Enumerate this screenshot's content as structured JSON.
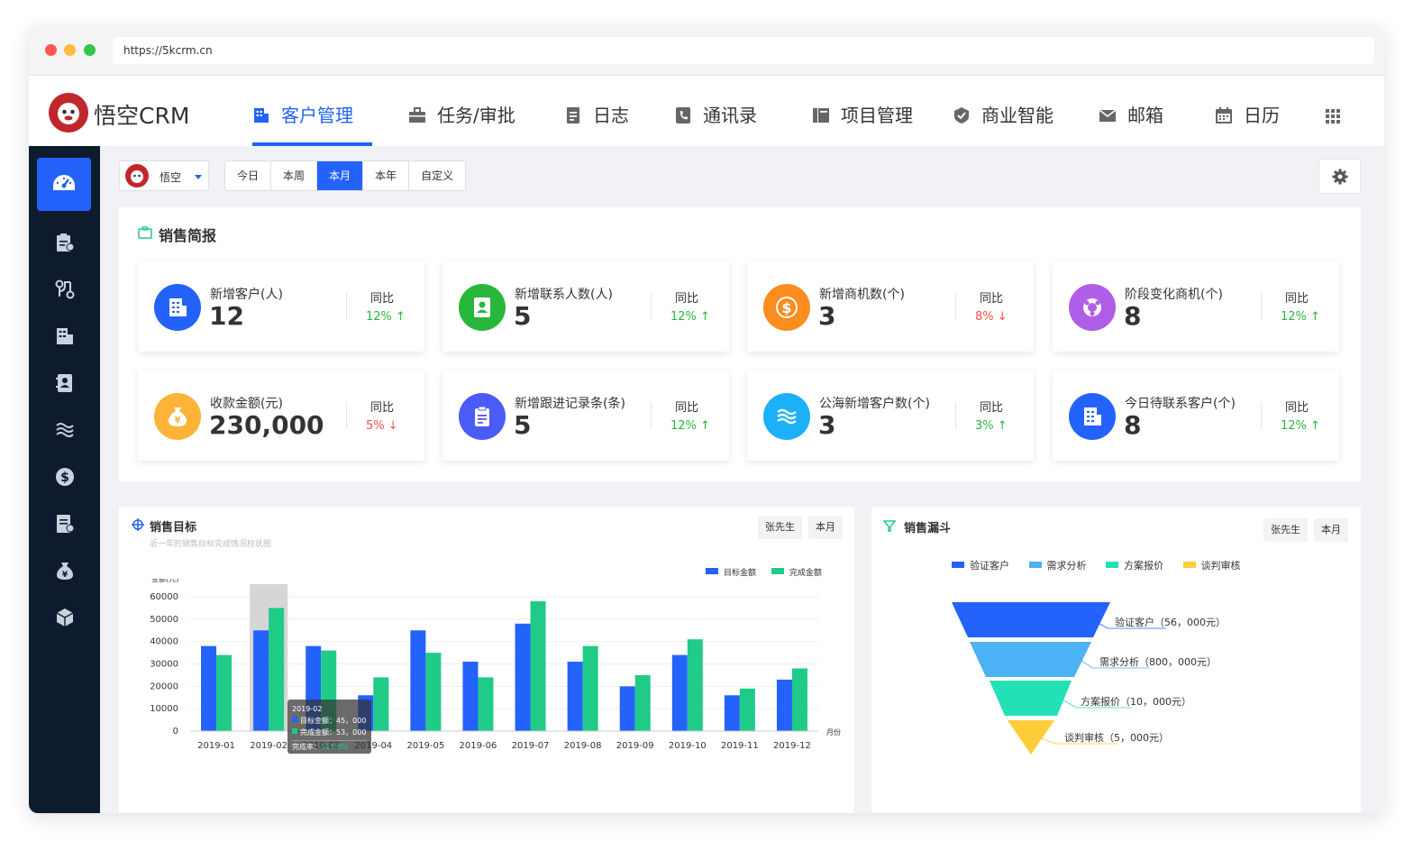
{
  "browser": {
    "url": "https://5kcrm.cn"
  },
  "app": {
    "logo_text": "悟空CRM"
  },
  "nav": {
    "items": [
      {
        "label": "客户管理",
        "icon": "building-icon",
        "active": true
      },
      {
        "label": "任务/审批",
        "icon": "briefcase-icon"
      },
      {
        "label": "日志",
        "icon": "log-icon"
      },
      {
        "label": "通讯录",
        "icon": "phone-book-icon"
      },
      {
        "label": "项目管理",
        "icon": "project-icon"
      },
      {
        "label": "商业智能",
        "icon": "shield-check-icon"
      },
      {
        "label": "邮箱",
        "icon": "mail-icon"
      },
      {
        "label": "日历",
        "icon": "calendar-icon"
      }
    ],
    "apps_icon": "grid-icon"
  },
  "sidebar": {
    "items": [
      "dashboard-icon",
      "clipboard-icon",
      "flow-icon",
      "building-icon",
      "contacts-icon",
      "waves-icon",
      "dollar-icon",
      "document-icon",
      "money-bag-icon",
      "cube-icon"
    ]
  },
  "filter": {
    "user": "悟空",
    "ranges": [
      "今日",
      "本周",
      "本月",
      "本年",
      "自定义"
    ],
    "active_range": "本月"
  },
  "summary": {
    "title": "销售简报",
    "yoy_label": "同比",
    "cards": [
      {
        "label": "新增客户(人)",
        "value": "12",
        "yoy": "12%",
        "trend": "up",
        "color": "#2362fb",
        "icon": "building-icon"
      },
      {
        "label": "新增联系人数(人)",
        "value": "5",
        "yoy": "12%",
        "trend": "up",
        "color": "#28b73a",
        "icon": "contact-card-icon"
      },
      {
        "label": "新增商机数(个)",
        "value": "3",
        "yoy": "8%",
        "trend": "down",
        "color": "#fb8c1e",
        "icon": "dollar-icon"
      },
      {
        "label": "阶段变化商机(个)",
        "value": "8",
        "yoy": "12%",
        "trend": "up",
        "color": "#b05de8",
        "icon": "stage-icon"
      },
      {
        "label": "收款金额(元)",
        "value": "230,000",
        "yoy": "5%",
        "trend": "down",
        "color": "#fcb337",
        "icon": "money-bag-icon"
      },
      {
        "label": "新增跟进记录条(条)",
        "value": "5",
        "yoy": "12%",
        "trend": "up",
        "color": "#4a5bf6",
        "icon": "clipboard-icon"
      },
      {
        "label": "公海新增客户数(个)",
        "value": "3",
        "yoy": "3%",
        "trend": "up",
        "color": "#1cb0f6",
        "icon": "waves-icon"
      },
      {
        "label": "今日待联系客户(个)",
        "value": "8",
        "yoy": "12%",
        "trend": "up",
        "color": "#2362fb",
        "icon": "building-icon"
      }
    ]
  },
  "target_panel": {
    "title": "销售目标",
    "subtitle": "近一年的销售目标完成情况柱状图",
    "person_btn": "张先生",
    "period_btn": "本月"
  },
  "funnel_panel": {
    "title": "销售漏斗",
    "person_btn": "张先生",
    "period_btn": "本月"
  },
  "chart_data": [
    {
      "type": "bar",
      "ylabel": "金额(元)",
      "xlabel": "月份",
      "ylim": [
        0,
        60000
      ],
      "yticks": [
        0,
        10000,
        20000,
        30000,
        40000,
        50000,
        60000
      ],
      "categories": [
        "2019-01",
        "2019-02",
        "2019-03",
        "2019-04",
        "2019-05",
        "2019-06",
        "2019-07",
        "2019-08",
        "2019-09",
        "2019-10",
        "2019-11",
        "2019-12"
      ],
      "series": [
        {
          "name": "目标金额",
          "color": "#2362fb",
          "values": [
            38000,
            45000,
            38000,
            16000,
            45000,
            31000,
            48000,
            31000,
            20000,
            34000,
            16000,
            23000
          ]
        },
        {
          "name": "完成金额",
          "color": "#20cb87",
          "values": [
            34000,
            55000,
            36000,
            24000,
            35000,
            24000,
            58000,
            38000,
            25000,
            41000,
            19000,
            28000
          ]
        }
      ],
      "highlight_index": 1,
      "tooltip": {
        "title": "2019-02",
        "rows": [
          "目标金额：45，000",
          "完成金额：53，000"
        ],
        "rate_label": "完成率：",
        "rate_value": "117.8%"
      }
    },
    {
      "type": "funnel",
      "legend_position": "top",
      "stages": [
        {
          "name": "验证客户",
          "label": "验证客户（56，000元）",
          "color": "#2362fb"
        },
        {
          "name": "需求分析",
          "label": "需求分析（800，000元）",
          "color": "#4ab2f5"
        },
        {
          "name": "方案报价",
          "label": "方案报价（10，000元）",
          "color": "#23e0b7"
        },
        {
          "name": "谈判审核",
          "label": "谈判审核（5，000元）",
          "color": "#ffcd3a"
        }
      ]
    }
  ]
}
